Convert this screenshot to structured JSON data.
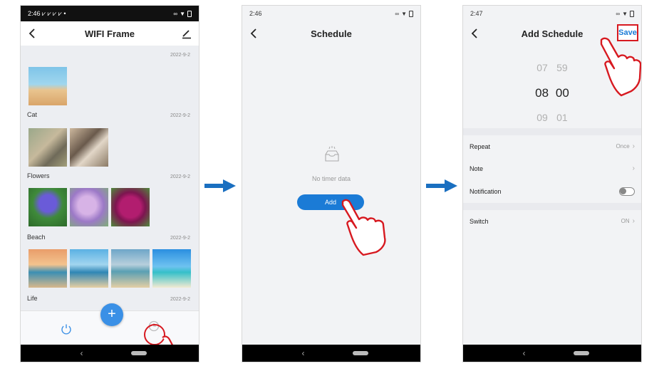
{
  "screen1": {
    "status_time": "2:46 ⩗ ⩗ ⩗ ⩗ •",
    "title": "WIFI Frame",
    "albums": [
      {
        "name": "",
        "date": "2022-9-2"
      },
      {
        "name": "Cat",
        "date": "2022-9-2"
      },
      {
        "name": "Flowers",
        "date": "2022-9-2"
      },
      {
        "name": "Beach",
        "date": "2022-9-2"
      },
      {
        "name": "Life",
        "date": "2022-9-2"
      }
    ],
    "fab_label": "+"
  },
  "screen2": {
    "status_time": "2:46",
    "title": "Schedule",
    "empty_text": "No timer data",
    "add_label": "Add"
  },
  "screen3": {
    "status_time": "2:47",
    "title": "Add Schedule",
    "save_label": "Save",
    "picker": {
      "prev_hour": "07",
      "prev_min": "59",
      "sel_hour": "08",
      "sel_min": "00",
      "next_hour": "09",
      "next_min": "01"
    },
    "repeat_label": "Repeat",
    "repeat_value": "Once",
    "note_label": "Note",
    "notification_label": "Notification",
    "switch_label": "Switch",
    "switch_value": "ON"
  },
  "nav_back_glyph": "‹",
  "chevron_glyph": "›",
  "colors": {
    "accent": "#1b7bd6",
    "highlight": "#d71920",
    "arrow": "#1a6fc0"
  },
  "icons": [
    "back-icon",
    "edit-icon",
    "power-icon",
    "clock-icon",
    "empty-box-icon",
    "pointing-hand-icon",
    "right-arrow-icon"
  ]
}
